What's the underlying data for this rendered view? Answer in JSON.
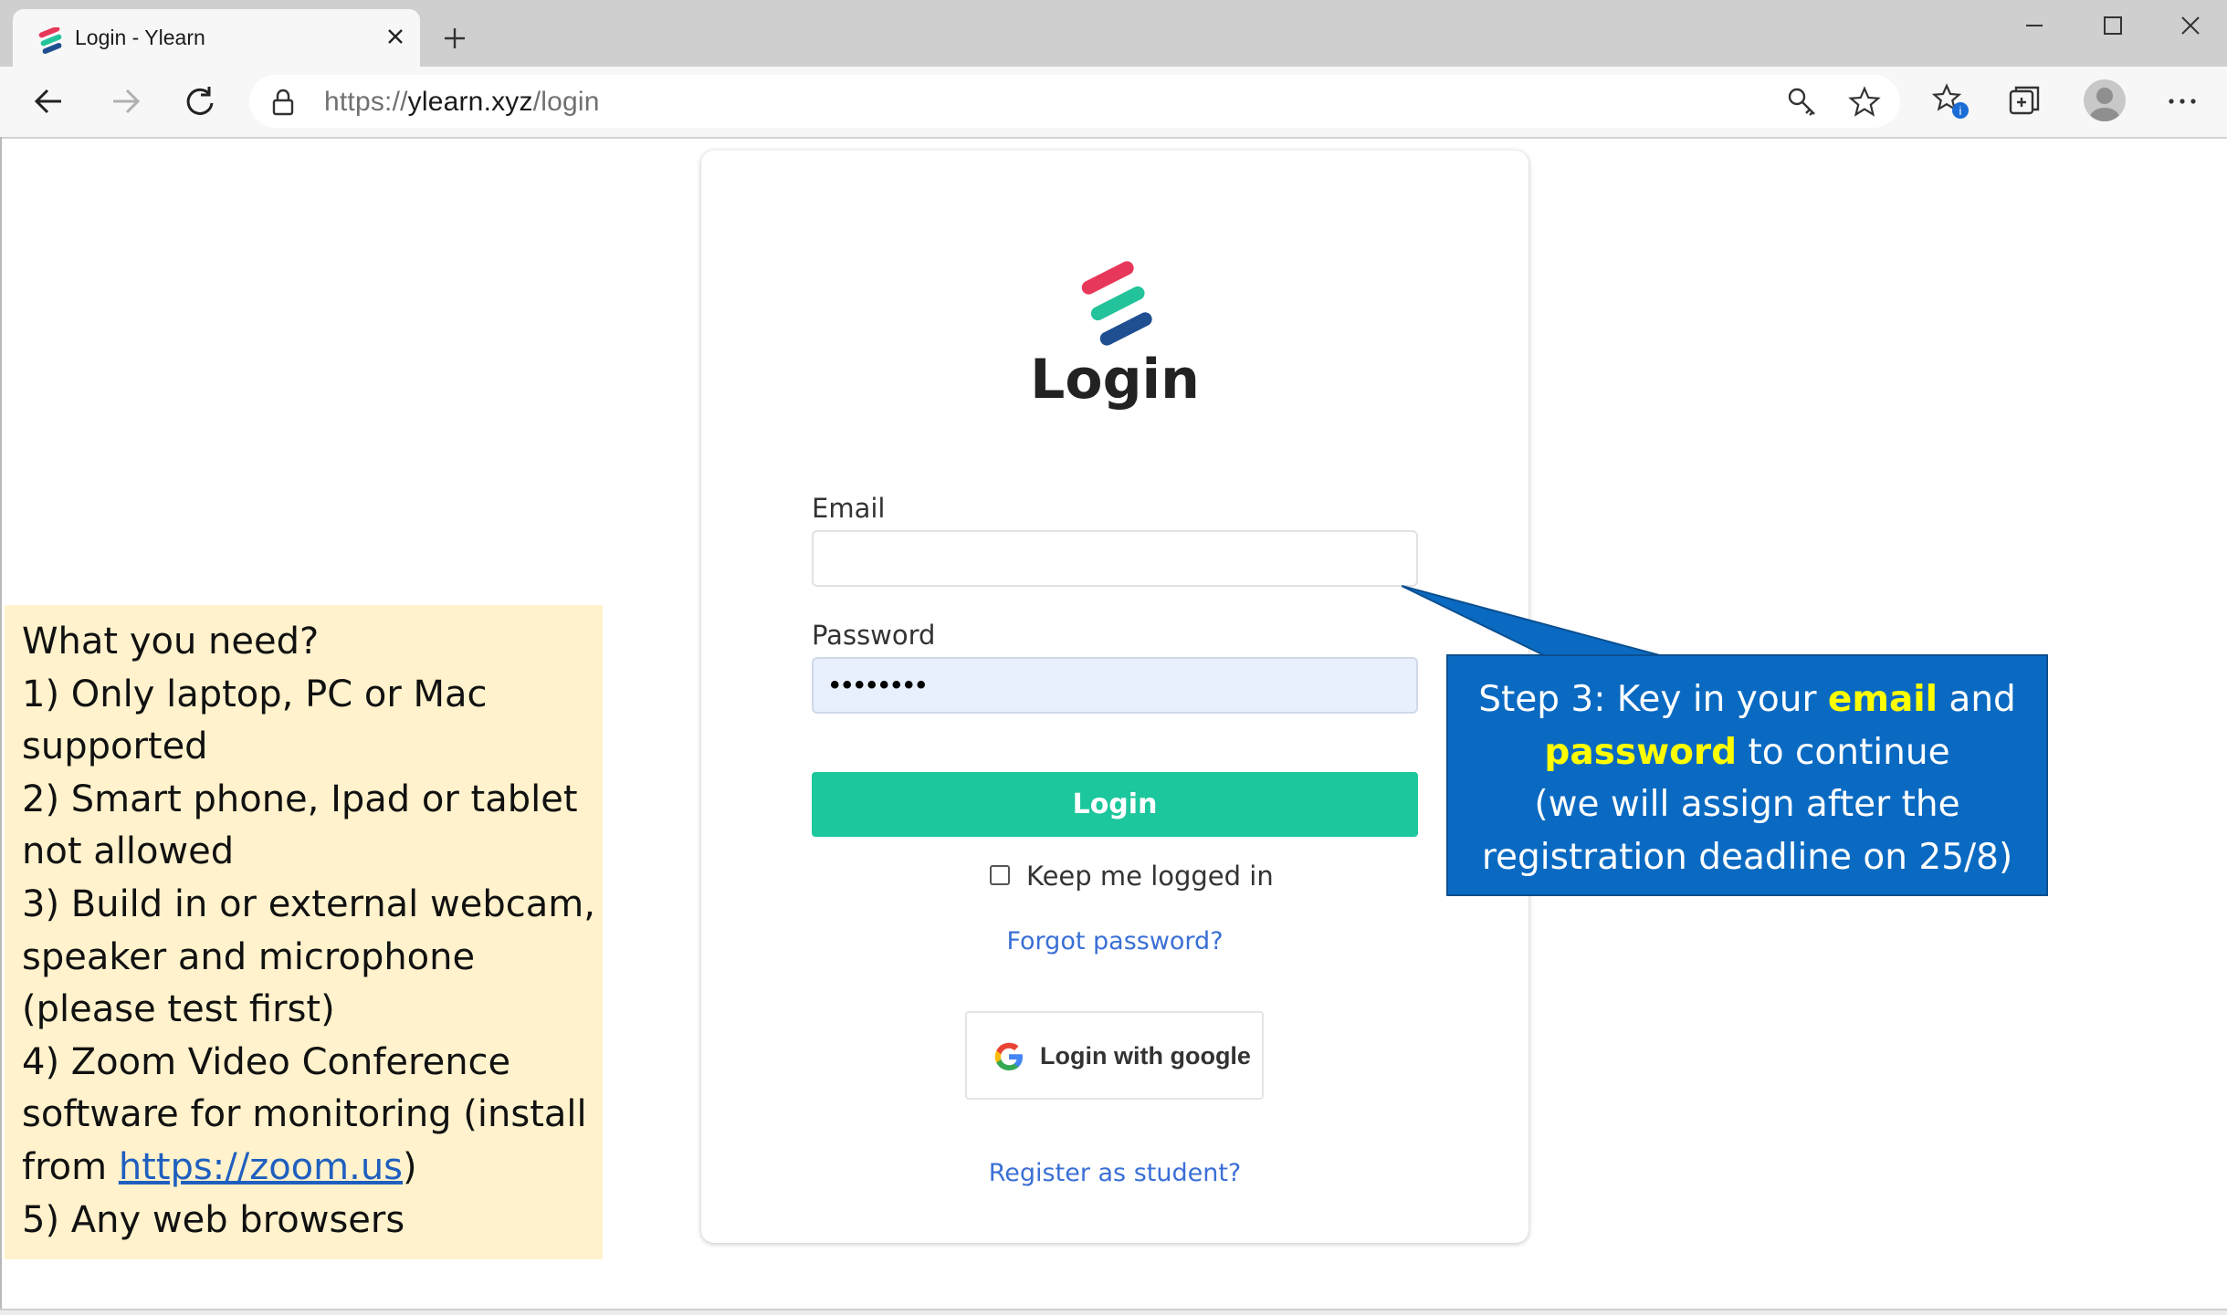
{
  "browser": {
    "tab_title": "Login - Ylearn",
    "url_prefix": "https://",
    "url_host": "ylearn.xyz",
    "url_path": "/login"
  },
  "login": {
    "title": "Login",
    "email_label": "Email",
    "email_value": "",
    "password_label": "Password",
    "password_value": "••••••••",
    "login_button": "Login",
    "keep_logged_in": "Keep me logged in",
    "forgot_password": "Forgot password?",
    "google_button": "Login with google",
    "register_link": "Register as student?",
    "logo_colors": [
      "#e8385a",
      "#22c39a",
      "#1f4f91"
    ],
    "accent": "#1dc79d"
  },
  "needs": {
    "line1": "What you need?",
    "line2": "1) Only laptop, PC or Mac",
    "line3": "supported",
    "line4": "2) Smart phone, Ipad or tablet",
    "line5": "not allowed",
    "line6": "3) Build in or external webcam,",
    "line7": "speaker and microphone",
    "line8": "(please test first)",
    "line9": "4) Zoom Video Conference",
    "line10": "software for monitoring (install",
    "line11_prefix": "from ",
    "line11_link": "https://zoom.us",
    "line11_suffix": ")",
    "line12": "5) Any web browsers"
  },
  "callout": {
    "part1": "Step 3: Key in your ",
    "email_word": "email",
    "part2": " and",
    "password_word": "password",
    "part3": " to continue",
    "line3": "(we will assign after the",
    "line4": "registration deadline on 25/8)"
  }
}
